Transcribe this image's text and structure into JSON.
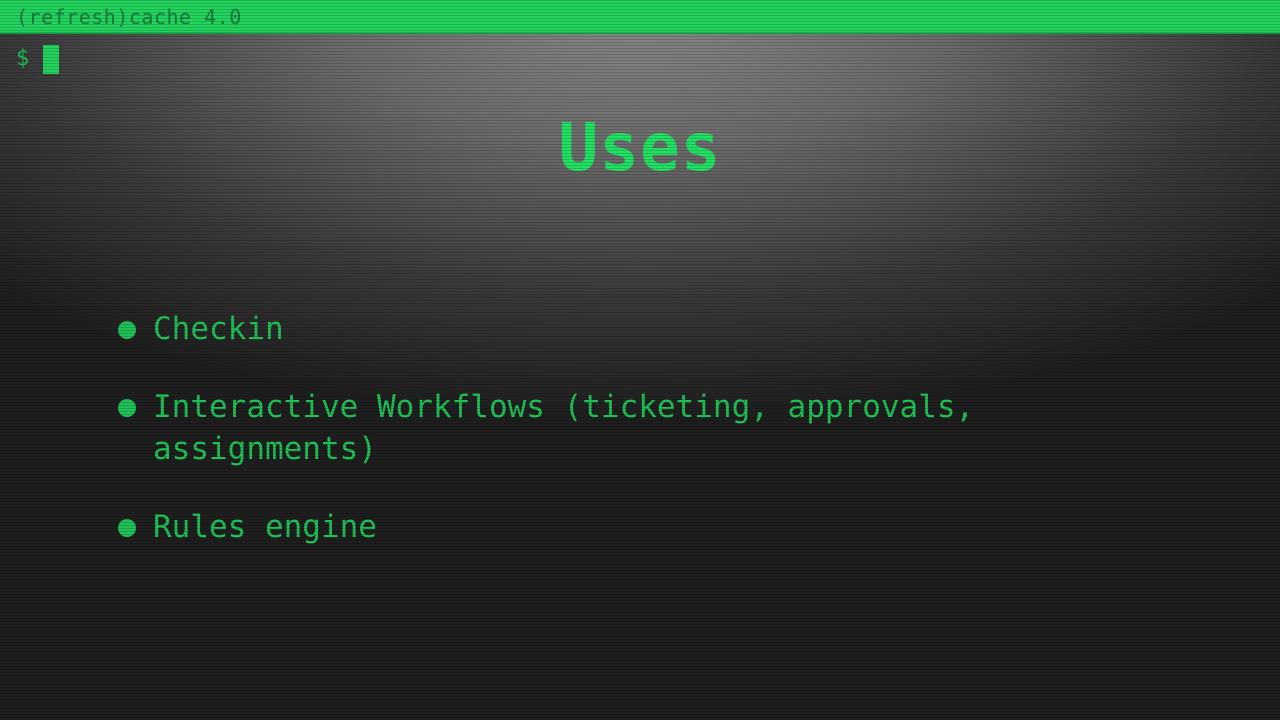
{
  "window": {
    "title": "(refresh)cache 4.0"
  },
  "prompt": {
    "symbol": "$"
  },
  "slide": {
    "title": "Uses",
    "bullets": [
      "Checkin",
      "Interactive Workflows (ticketing, approvals, assignments)",
      "Rules engine"
    ]
  },
  "colors": {
    "accent_green": "#22d35e",
    "text_green": "#1fc156",
    "background": "#1e1e1e"
  },
  "icons": {
    "cursor": "block-cursor-icon",
    "bullet": "bullet-dot-icon"
  }
}
